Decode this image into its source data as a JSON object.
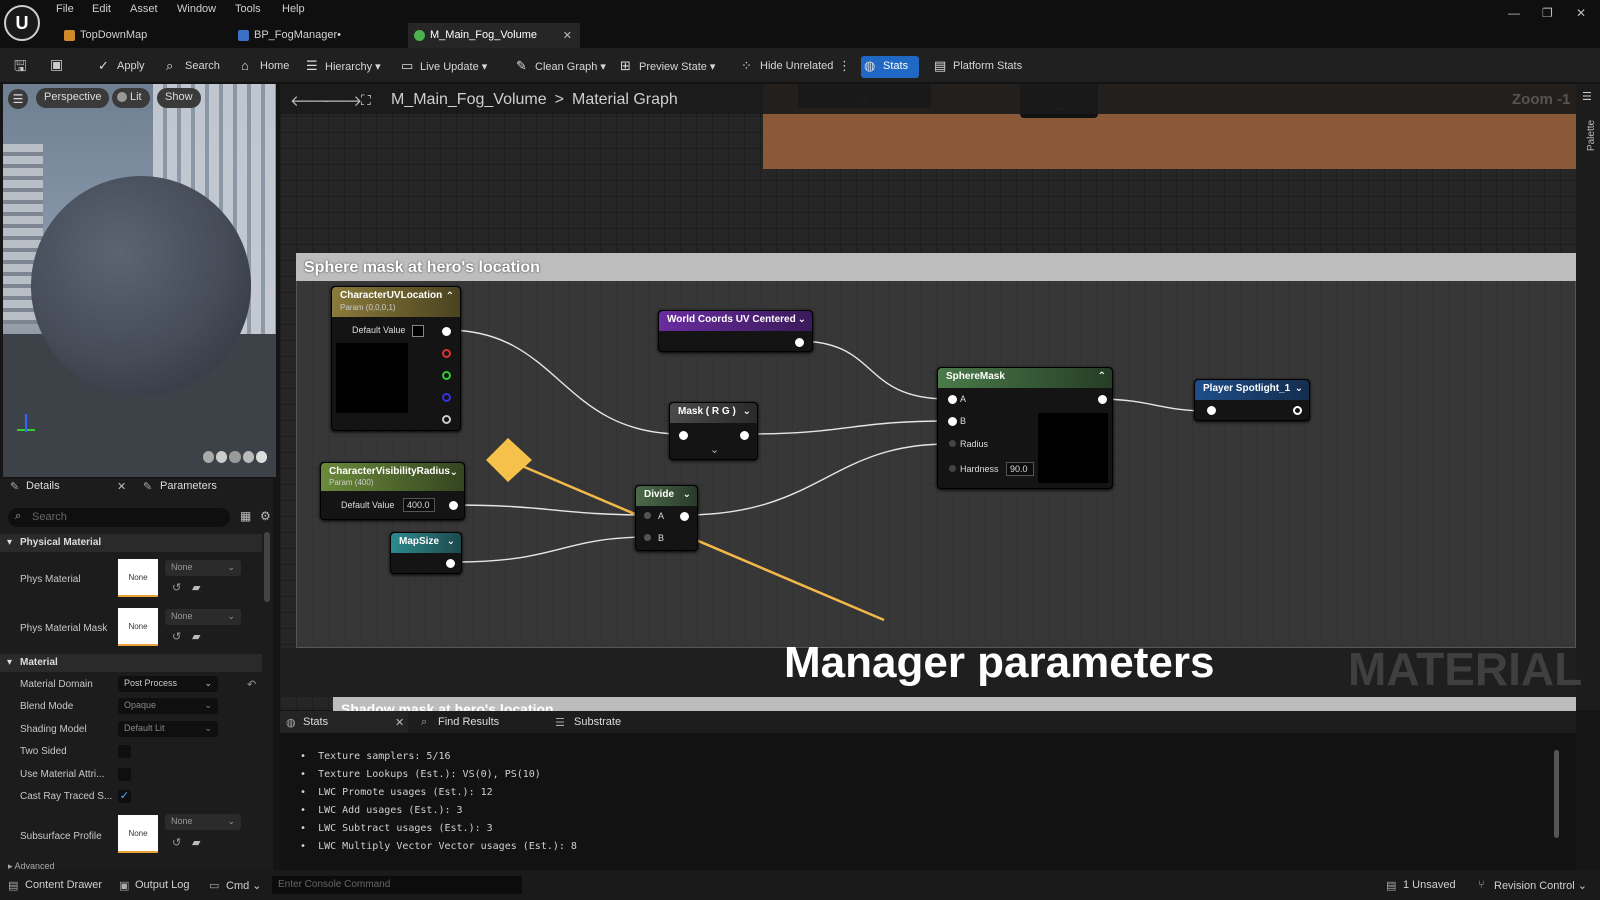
{
  "menu": [
    "File",
    "Edit",
    "Asset",
    "Window",
    "Tools",
    "Help"
  ],
  "tabs": [
    {
      "label": "TopDownMap"
    },
    {
      "label": "BP_FogManager•"
    },
    {
      "label": "M_Main_Fog_Volume"
    }
  ],
  "toolbar": {
    "apply": "Apply",
    "search": "Search",
    "home": "Home",
    "hierarchy": "Hierarchy",
    "live_update": "Live Update",
    "clean_graph": "Clean Graph",
    "preview_state": "Preview State",
    "hide_unrelated": "Hide Unrelated",
    "stats": "Stats",
    "platform_stats": "Platform Stats"
  },
  "viewport": {
    "perspective": "Perspective",
    "lit": "Lit",
    "show": "Show"
  },
  "details": {
    "tab": "Details",
    "params_tab": "Parameters",
    "search_placeholder": "Search",
    "physical_material": "Physical Material",
    "phys_material": "Phys Material",
    "phys_material_mask": "Phys Material Mask",
    "none": "None",
    "material": "Material",
    "material_domain": "Material Domain",
    "material_domain_val": "Post Process",
    "blend_mode": "Blend Mode",
    "blend_mode_val": "Opaque",
    "shading_model": "Shading Model",
    "shading_model_val": "Default Lit",
    "two_sided": "Two Sided",
    "use_material_attr": "Use Material Attri...",
    "cast_ray": "Cast Ray Traced S...",
    "subsurface": "Subsurface Profile",
    "advanced": "Advanced"
  },
  "breadcrumb": {
    "asset": "M_Main_Fog_Volume",
    "graph": "Material Graph"
  },
  "zoom": "Zoom -1",
  "palette": "Palette",
  "comment": {
    "title": "Sphere mask at hero's location",
    "lower_title": "Shadow mask at hero's location"
  },
  "nodes": {
    "char_uv": {
      "title": "CharacterUVLocation",
      "sub": "Param (0,0,0,1)",
      "default_label": "Default Value"
    },
    "char_vis": {
      "title": "CharacterVisibilityRadius",
      "sub": "Param (400)",
      "default_label": "Default Value",
      "default_val": "400.0"
    },
    "mapsize": {
      "title": "MapSize"
    },
    "world_coords": {
      "title": "World Coords UV Centered"
    },
    "mask": {
      "title": "Mask ( R G )"
    },
    "divide": {
      "title": "Divide",
      "a": "A",
      "b": "B"
    },
    "spheremask": {
      "title": "SphereMask",
      "a": "A",
      "b": "B",
      "radius": "Radius",
      "hardness": "Hardness",
      "hardness_val": "90.0"
    },
    "spotlight": {
      "title": "Player Spotlight_1"
    }
  },
  "overlay_title": "Manager parameters",
  "watermark": "MATERIAL",
  "bottom_tabs": {
    "stats": "Stats",
    "find": "Find Results",
    "substrate": "Substrate"
  },
  "stats": [
    "Texture samplers: 5/16",
    "Texture Lookups (Est.): VS(0), PS(10)",
    "LWC Promote usages (Est.): 12",
    "LWC Add usages (Est.): 3",
    "LWC Subtract usages (Est.): 3",
    "LWC Multiply Vector Vector usages (Est.): 8"
  ],
  "statusbar": {
    "content_drawer": "Content Drawer",
    "output_log": "Output Log",
    "cmd": "Cmd",
    "console_placeholder": "Enter Console Command",
    "unsaved": "1 Unsaved",
    "revision": "Revision Control"
  }
}
